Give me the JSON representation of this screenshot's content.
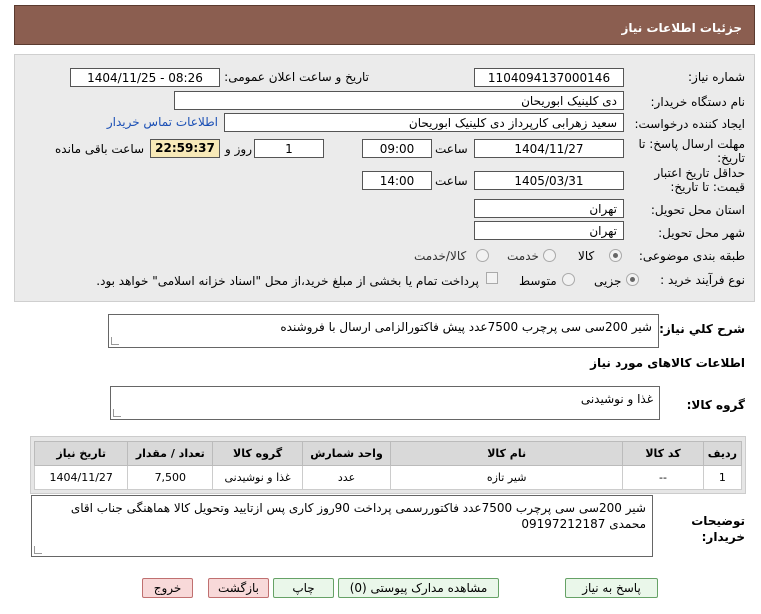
{
  "header": {
    "title": "جزئیات اطلاعات نیاز"
  },
  "form": {
    "need_number_label": "شماره نیاز:",
    "need_number": "1104094137000146",
    "announce_label": "تاریخ و ساعت اعلان عمومی:",
    "announce_value": "1404/11/25 - 08:26",
    "buyer_org_label": "نام دستگاه خریدار:",
    "buyer_org": "دی کلینیک ابوریحان",
    "creator_label": "ایجاد کننده درخواست:",
    "creator": "سعید زهرابی کارپرداز دی کلینیک ابوریحان",
    "contact_link": "اطلاعات تماس خریدار",
    "reply_deadline_label_1": "مهلت ارسال پاسخ: تا",
    "reply_deadline_label_2": "تاریخ:",
    "reply_date": "1404/11/27",
    "time_label": "ساعت",
    "reply_time": "09:00",
    "days": "1",
    "days_label": "روز و",
    "remaining": "22:59:37",
    "remaining_label": "ساعت باقی مانده",
    "validity_label_1": "حداقل تاریخ اعتبار",
    "validity_label_2": "قیمت: تا تاریخ:",
    "validity_date": "1405/03/31",
    "validity_time": "14:00",
    "province_label": "استان محل تحویل:",
    "province": "تهران",
    "city_label": "شهر محل تحویل:",
    "city": "تهران",
    "category_label": "طبقه بندی موضوعی:",
    "category_options": [
      "کالا",
      "خدمت",
      "کالا/خدمت"
    ],
    "process_label": "نوع فرآیند خرید :",
    "process_options": [
      "جزیی",
      "متوسط"
    ],
    "treasury_note": "پرداخت تمام یا بخشی از مبلغ خرید،از محل \"اسناد خزانه اسلامی\" خواهد بود."
  },
  "description": {
    "label": "شرح کلي نياز:",
    "text": "شیر 200سی سی پرچرب 7500عدد پیش فاکتورالزامی ارسال با فروشنده"
  },
  "goods_section": {
    "title": "اطلاعات کالاهای مورد نیاز",
    "group_label": "گروه کالا:",
    "group_value": "غذا و نوشیدنی"
  },
  "table": {
    "headers": [
      "ردیف",
      "کد کالا",
      "نام کالا",
      "واحد شمارش",
      "گروه کالا",
      "تعداد / مقدار",
      "تاریخ نیاز"
    ],
    "rows": [
      [
        "1",
        "--",
        "شیر تازه",
        "عدد",
        "غذا و نوشیدنی",
        "7,500",
        "1404/11/27"
      ]
    ]
  },
  "buyer_notes": {
    "label_1": "توضیحات",
    "label_2": "خریدار:",
    "text": "شیر 200سی سی پرچرب 7500عدد فاکتوررسمی پرداخت 90روز کاری پس ازتایید وتحویل کالا هماهنگی جناب اقای محمدی 09197212187"
  },
  "buttons": {
    "reply": "پاسخ به نیاز",
    "attachments": "مشاهده مدارک پیوستی (0)",
    "print": "چاپ",
    "back": "بازگشت",
    "exit": "خروج"
  }
}
